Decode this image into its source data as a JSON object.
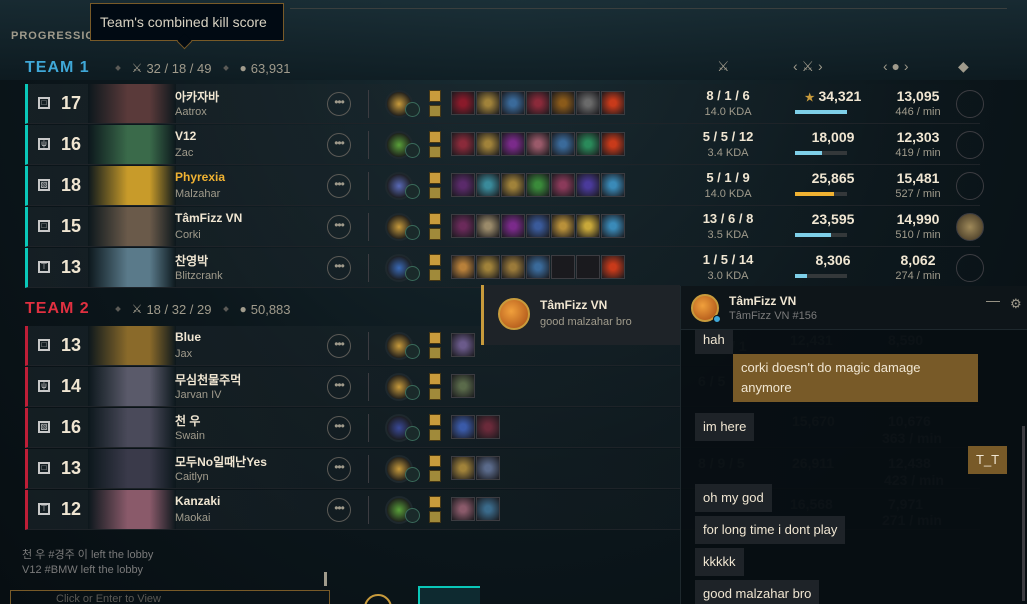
{
  "tooltip": "Team's combined kill score",
  "tab_label": "PROGRESSIO",
  "team1": {
    "name": "TEAM 1",
    "kills": "32 / 18 / 49",
    "gold": "63,931",
    "color": "#3fa8d8"
  },
  "team2": {
    "name": "TEAM 2",
    "kills": "18 / 32 / 29",
    "gold": "50,883",
    "color": "#e03040"
  },
  "players": [
    {
      "lvl": "17",
      "name": "아카자바",
      "champ": "Aatrox",
      "kda": "8 / 1 / 6",
      "kdasub": "14.0 KDA",
      "dmg": "34,321",
      "star": "★",
      "dmgpct": 1.0,
      "dmgcolor": "#7ecfe8",
      "gold": "13,095",
      "goldsub": "446 / min",
      "team": "t1",
      "role": "□",
      "hl": false,
      "portrait": "#5a3a3a",
      "rune": "#c89b3c",
      "items": [
        "#8a1a2a",
        "#a0823a",
        "#3a6a9a",
        "#8a2a3a",
        "#8a5a1a",
        "#6a6a6a",
        "#c83a1a"
      ]
    },
    {
      "lvl": "16",
      "name": "V12",
      "champ": "Zac",
      "kda": "5 / 5 / 12",
      "kdasub": "3.4 KDA",
      "dmg": "18,009",
      "star": "",
      "dmgpct": 0.52,
      "dmgcolor": "#7ecfe8",
      "gold": "12,303",
      "goldsub": "419 / min",
      "team": "t1",
      "role": "ψ",
      "hl": false,
      "portrait": "#3a6a4a",
      "rune": "#5aa03a",
      "items": [
        "#8a2a3a",
        "#a0823a",
        "#7a2a8a",
        "#9a5a6a",
        "#3a6a9a",
        "#2a8a5a",
        "#c83a1a"
      ]
    },
    {
      "lvl": "18",
      "name": "Phyrexia",
      "champ": "Malzahar",
      "kda": "5 / 1 / 9",
      "kdasub": "14.0 KDA",
      "dmg": "25,865",
      "star": "",
      "dmgpct": 0.75,
      "dmgcolor": "#f0b232",
      "gold": "15,481",
      "goldsub": "527 / min",
      "team": "t1",
      "role": "▧",
      "hl": true,
      "portrait": "#c89b2a",
      "rune": "#5a6ab8",
      "items": [
        "#5a2a6a",
        "#3a8a9a",
        "#a0823a",
        "#3a8a3a",
        "#8a3a5a",
        "#4a3a9a",
        "#3a8ab8"
      ]
    },
    {
      "lvl": "15",
      "name": "TâmFizz VN",
      "champ": "Corki",
      "kda": "13 / 6 / 8",
      "kdasub": "3.5 KDA",
      "dmg": "23,595",
      "star": "",
      "dmgpct": 0.69,
      "dmgcolor": "#7ecfe8",
      "gold": "14,990",
      "goldsub": "510 / min",
      "team": "t1",
      "role": "□",
      "hl": false,
      "portrait": "#6a5a4a",
      "rune": "#c89b3c",
      "items": [
        "#6a2a5a",
        "#9a8a6a",
        "#7a2a8a",
        "#3a5a9a",
        "#b8903a",
        "#c8a83a",
        "#3a8ab8"
      ]
    },
    {
      "lvl": "13",
      "name": "찬영박",
      "champ": "Blitzcrank",
      "kda": "1 / 5 / 14",
      "kdasub": "3.0 KDA",
      "dmg": "8,306",
      "star": "",
      "dmgpct": 0.24,
      "dmgcolor": "#7ecfe8",
      "gold": "8,062",
      "goldsub": "274 / min",
      "team": "t1",
      "role": "⊤",
      "hl": false,
      "portrait": "#5a7a8a",
      "rune": "#3a6ab8",
      "items": [
        "#b8803a",
        "#a0823a",
        "#9a7a3a",
        "#3a6a9a",
        "#1a1a1e",
        "#1a1a1e",
        "#c83a1a"
      ]
    },
    {
      "lvl": "13",
      "name": "Blue",
      "champ": "Jax",
      "team": "t2",
      "role": "□",
      "hl": false,
      "portrait": "#8a6a2a",
      "rune": "#c89b3c",
      "items": [
        "#6a5a8a"
      ]
    },
    {
      "lvl": "14",
      "name": "무심천물주먹",
      "champ": "Jarvan IV",
      "team": "t2",
      "role": "ψ",
      "hl": false,
      "portrait": "#5a5a6a",
      "rune": "#c89b3c",
      "items": [
        "#5a6a4a"
      ]
    },
    {
      "lvl": "16",
      "name": "천 우",
      "champ": "Swain",
      "team": "t2",
      "role": "▧",
      "hl": false,
      "portrait": "#4a4a5a",
      "rune": "#3a4a9a",
      "items": [
        "#3a5aa8",
        "#6a2a3a"
      ]
    },
    {
      "lvl": "13",
      "name": "모두No일때난Yes",
      "champ": "Caitlyn",
      "team": "t2",
      "role": "□",
      "hl": false,
      "portrait": "#3a3a4a",
      "rune": "#c89b3c",
      "items": [
        "#a0823a",
        "#5a6a8a"
      ]
    },
    {
      "lvl": "12",
      "name": "Kanzaki",
      "champ": "Maokai",
      "team": "t2",
      "role": "⊤",
      "hl": false,
      "portrait": "#8a5a6a",
      "rune": "#5aa03a",
      "items": [
        "#8a5a6a",
        "#3a6a8a"
      ]
    }
  ],
  "lobby": [
    "천 우 #경주 이 left the lobby",
    "V12 #BMW left the lobby"
  ],
  "chat_input_placeholder": "Click or Enter to View",
  "notif": {
    "name": "TâmFizz VN",
    "text": "good malzahar bro"
  },
  "chat": {
    "title": "TâmFizz VN",
    "subtitle": "TâmFizz VN #156",
    "messages": [
      {
        "text": "hah",
        "dir": "in"
      },
      {
        "text": "corki doesn't do magic damage anymore",
        "dir": "out"
      },
      {
        "text": "im here",
        "dir": "in"
      },
      {
        "text": "T_T",
        "dir": "out"
      },
      {
        "text": "oh my god",
        "dir": "in"
      },
      {
        "text": "for long time i dont play",
        "dir": "in"
      },
      {
        "text": "kkkkk",
        "dir": "in"
      },
      {
        "text": "good malzahar bro",
        "dir": "in"
      }
    ]
  },
  "bg_ghost": {
    "r1": "8 / 5 / 1",
    "r1b": "12,431",
    "r1c": "8,590",
    "r2": "6 / 5",
    "r3": "15,670",
    "r3b": "10,676",
    "r3c": "363 / min",
    "r4": "8 / 9 / 5",
    "r4b": "26,911",
    "r4c": "12,438",
    "r4d": "423 / min",
    "r5": "16,568",
    "r5b": "7,971",
    "r5c": "271 / min"
  }
}
